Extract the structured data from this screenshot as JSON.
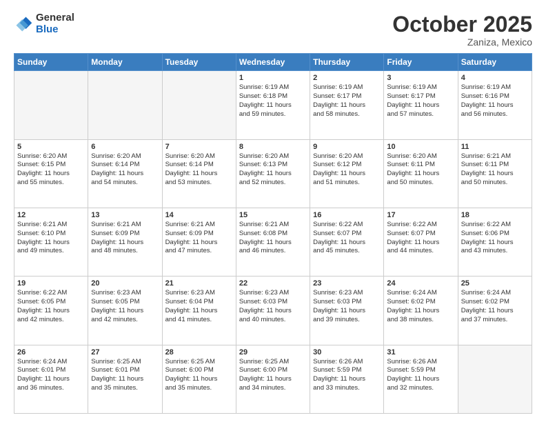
{
  "header": {
    "logo_general": "General",
    "logo_blue": "Blue",
    "month_title": "October 2025",
    "location": "Zaniza, Mexico"
  },
  "weekdays": [
    "Sunday",
    "Monday",
    "Tuesday",
    "Wednesday",
    "Thursday",
    "Friday",
    "Saturday"
  ],
  "weeks": [
    [
      {
        "day": "",
        "info": ""
      },
      {
        "day": "",
        "info": ""
      },
      {
        "day": "",
        "info": ""
      },
      {
        "day": "1",
        "info": "Sunrise: 6:19 AM\nSunset: 6:18 PM\nDaylight: 11 hours\nand 59 minutes."
      },
      {
        "day": "2",
        "info": "Sunrise: 6:19 AM\nSunset: 6:17 PM\nDaylight: 11 hours\nand 58 minutes."
      },
      {
        "day": "3",
        "info": "Sunrise: 6:19 AM\nSunset: 6:17 PM\nDaylight: 11 hours\nand 57 minutes."
      },
      {
        "day": "4",
        "info": "Sunrise: 6:19 AM\nSunset: 6:16 PM\nDaylight: 11 hours\nand 56 minutes."
      }
    ],
    [
      {
        "day": "5",
        "info": "Sunrise: 6:20 AM\nSunset: 6:15 PM\nDaylight: 11 hours\nand 55 minutes."
      },
      {
        "day": "6",
        "info": "Sunrise: 6:20 AM\nSunset: 6:14 PM\nDaylight: 11 hours\nand 54 minutes."
      },
      {
        "day": "7",
        "info": "Sunrise: 6:20 AM\nSunset: 6:14 PM\nDaylight: 11 hours\nand 53 minutes."
      },
      {
        "day": "8",
        "info": "Sunrise: 6:20 AM\nSunset: 6:13 PM\nDaylight: 11 hours\nand 52 minutes."
      },
      {
        "day": "9",
        "info": "Sunrise: 6:20 AM\nSunset: 6:12 PM\nDaylight: 11 hours\nand 51 minutes."
      },
      {
        "day": "10",
        "info": "Sunrise: 6:20 AM\nSunset: 6:11 PM\nDaylight: 11 hours\nand 50 minutes."
      },
      {
        "day": "11",
        "info": "Sunrise: 6:21 AM\nSunset: 6:11 PM\nDaylight: 11 hours\nand 50 minutes."
      }
    ],
    [
      {
        "day": "12",
        "info": "Sunrise: 6:21 AM\nSunset: 6:10 PM\nDaylight: 11 hours\nand 49 minutes."
      },
      {
        "day": "13",
        "info": "Sunrise: 6:21 AM\nSunset: 6:09 PM\nDaylight: 11 hours\nand 48 minutes."
      },
      {
        "day": "14",
        "info": "Sunrise: 6:21 AM\nSunset: 6:09 PM\nDaylight: 11 hours\nand 47 minutes."
      },
      {
        "day": "15",
        "info": "Sunrise: 6:21 AM\nSunset: 6:08 PM\nDaylight: 11 hours\nand 46 minutes."
      },
      {
        "day": "16",
        "info": "Sunrise: 6:22 AM\nSunset: 6:07 PM\nDaylight: 11 hours\nand 45 minutes."
      },
      {
        "day": "17",
        "info": "Sunrise: 6:22 AM\nSunset: 6:07 PM\nDaylight: 11 hours\nand 44 minutes."
      },
      {
        "day": "18",
        "info": "Sunrise: 6:22 AM\nSunset: 6:06 PM\nDaylight: 11 hours\nand 43 minutes."
      }
    ],
    [
      {
        "day": "19",
        "info": "Sunrise: 6:22 AM\nSunset: 6:05 PM\nDaylight: 11 hours\nand 42 minutes."
      },
      {
        "day": "20",
        "info": "Sunrise: 6:23 AM\nSunset: 6:05 PM\nDaylight: 11 hours\nand 42 minutes."
      },
      {
        "day": "21",
        "info": "Sunrise: 6:23 AM\nSunset: 6:04 PM\nDaylight: 11 hours\nand 41 minutes."
      },
      {
        "day": "22",
        "info": "Sunrise: 6:23 AM\nSunset: 6:03 PM\nDaylight: 11 hours\nand 40 minutes."
      },
      {
        "day": "23",
        "info": "Sunrise: 6:23 AM\nSunset: 6:03 PM\nDaylight: 11 hours\nand 39 minutes."
      },
      {
        "day": "24",
        "info": "Sunrise: 6:24 AM\nSunset: 6:02 PM\nDaylight: 11 hours\nand 38 minutes."
      },
      {
        "day": "25",
        "info": "Sunrise: 6:24 AM\nSunset: 6:02 PM\nDaylight: 11 hours\nand 37 minutes."
      }
    ],
    [
      {
        "day": "26",
        "info": "Sunrise: 6:24 AM\nSunset: 6:01 PM\nDaylight: 11 hours\nand 36 minutes."
      },
      {
        "day": "27",
        "info": "Sunrise: 6:25 AM\nSunset: 6:01 PM\nDaylight: 11 hours\nand 35 minutes."
      },
      {
        "day": "28",
        "info": "Sunrise: 6:25 AM\nSunset: 6:00 PM\nDaylight: 11 hours\nand 35 minutes."
      },
      {
        "day": "29",
        "info": "Sunrise: 6:25 AM\nSunset: 6:00 PM\nDaylight: 11 hours\nand 34 minutes."
      },
      {
        "day": "30",
        "info": "Sunrise: 6:26 AM\nSunset: 5:59 PM\nDaylight: 11 hours\nand 33 minutes."
      },
      {
        "day": "31",
        "info": "Sunrise: 6:26 AM\nSunset: 5:59 PM\nDaylight: 11 hours\nand 32 minutes."
      },
      {
        "day": "",
        "info": ""
      }
    ]
  ]
}
